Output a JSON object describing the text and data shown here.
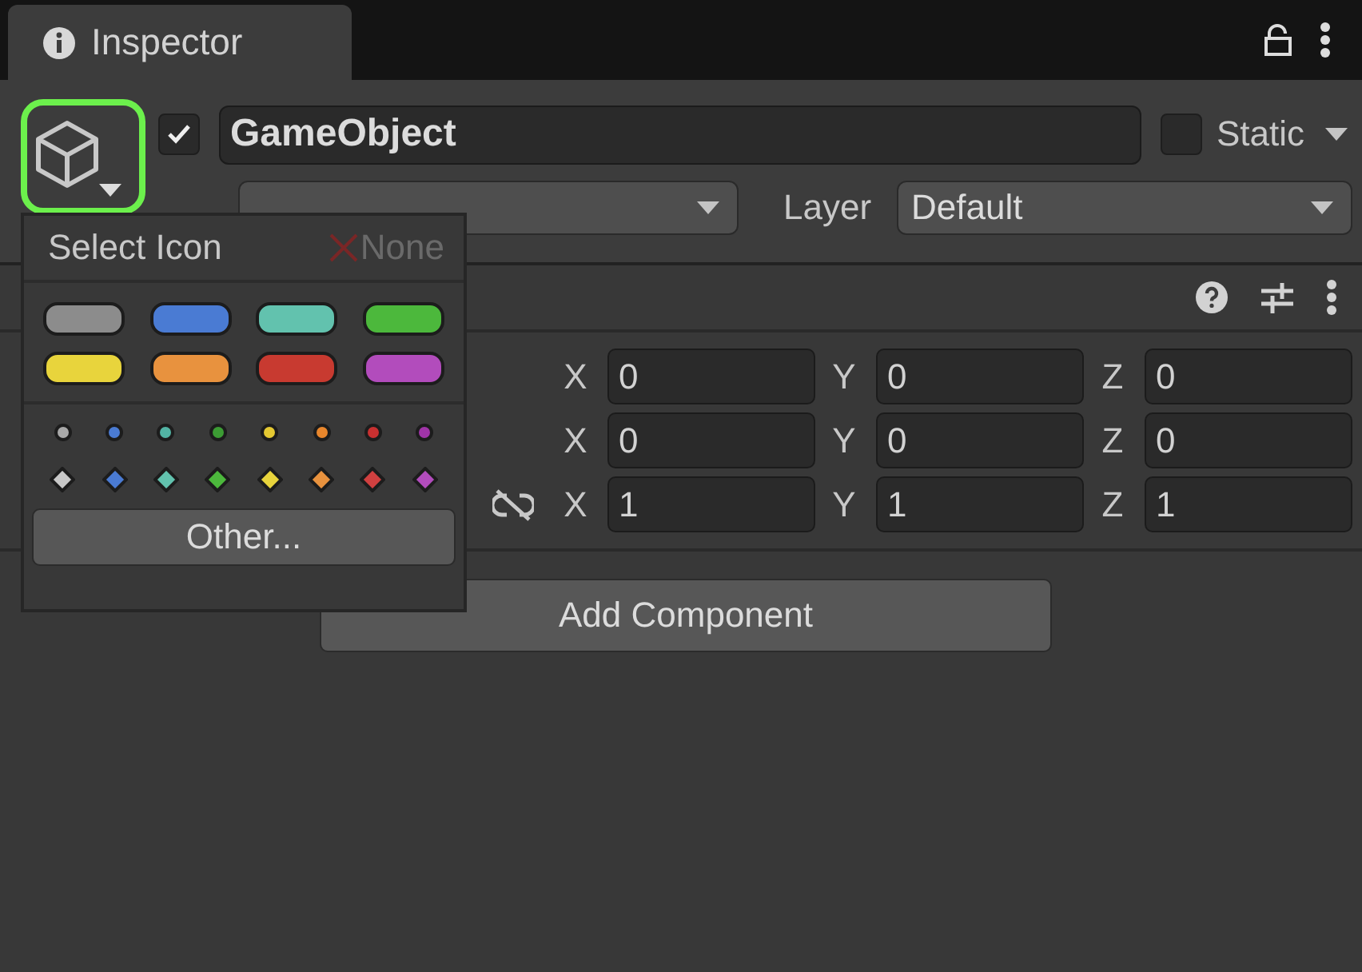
{
  "tab": {
    "title": "Inspector"
  },
  "header": {
    "active": true,
    "name": "GameObject",
    "static": false,
    "static_label": "Static",
    "layer_label": "Layer",
    "layer": "Default"
  },
  "transform": {
    "rows": [
      {
        "link_toggle": false,
        "fields": [
          {
            "axis": "X",
            "value": "0"
          },
          {
            "axis": "Y",
            "value": "0"
          },
          {
            "axis": "Z",
            "value": "0"
          }
        ]
      },
      {
        "link_toggle": false,
        "fields": [
          {
            "axis": "X",
            "value": "0"
          },
          {
            "axis": "Y",
            "value": "0"
          },
          {
            "axis": "Z",
            "value": "0"
          }
        ]
      },
      {
        "link_toggle": true,
        "fields": [
          {
            "axis": "X",
            "value": "1"
          },
          {
            "axis": "Y",
            "value": "1"
          },
          {
            "axis": "Z",
            "value": "1"
          }
        ]
      }
    ]
  },
  "add_component": "Add Component",
  "icon_popup": {
    "title": "Select Icon",
    "none": "None",
    "labels": [
      {
        "color": "#8c8c8c"
      },
      {
        "color": "#4a7bd3"
      },
      {
        "color": "#62c2ae"
      },
      {
        "color": "#4cb83c"
      },
      {
        "color": "#e8d43c"
      },
      {
        "color": "#e8923e"
      },
      {
        "color": "#c83a30"
      },
      {
        "color": "#b24cbc"
      }
    ],
    "dots": [
      {
        "color": "#a8a8a8"
      },
      {
        "color": "#4a7bd3"
      },
      {
        "color": "#52b4a4"
      },
      {
        "color": "#3c9c34"
      },
      {
        "color": "#e4c832"
      },
      {
        "color": "#e8862c"
      },
      {
        "color": "#c83030"
      },
      {
        "color": "#a034a8"
      }
    ],
    "diamonds": [
      {
        "color": "#c8c8c8"
      },
      {
        "color": "#4a7bd3"
      },
      {
        "color": "#62c2ae"
      },
      {
        "color": "#4cb83c"
      },
      {
        "color": "#e8d43c"
      },
      {
        "color": "#e8923e"
      },
      {
        "color": "#d04040"
      },
      {
        "color": "#b24cbc"
      }
    ],
    "other": "Other..."
  }
}
